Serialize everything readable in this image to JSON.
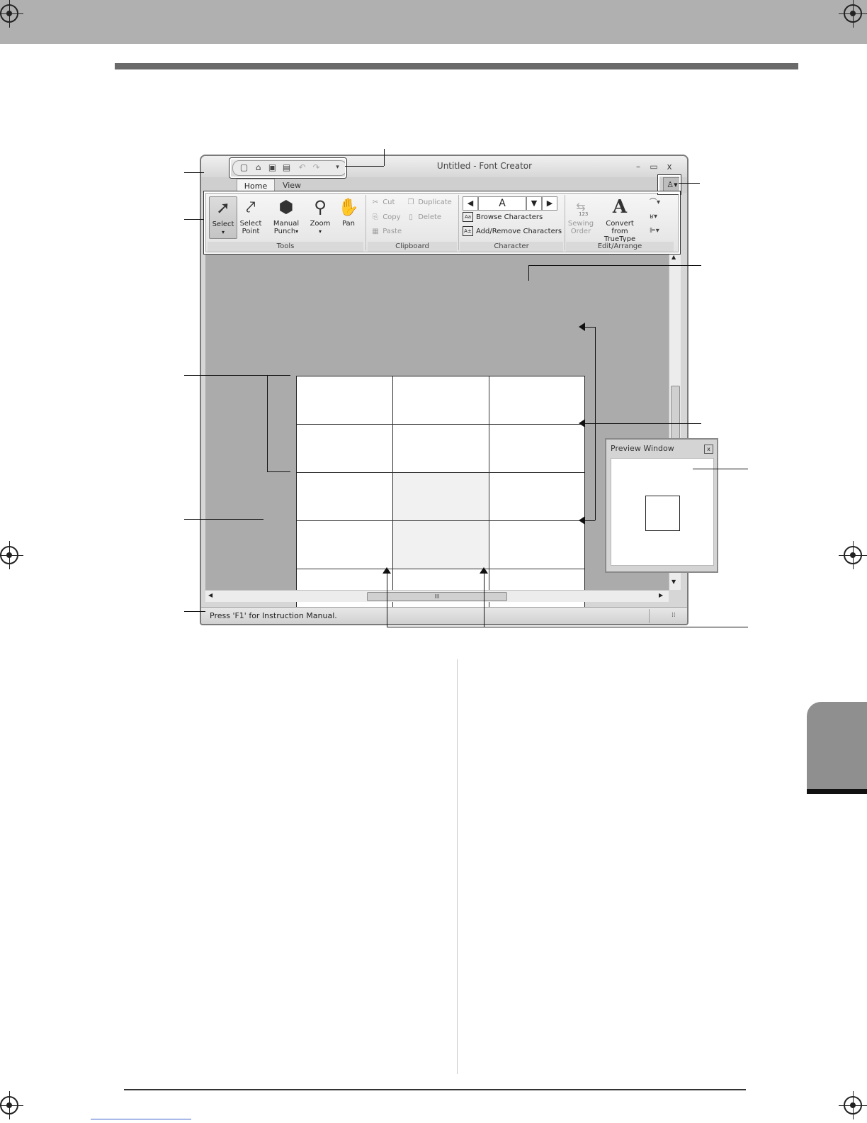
{
  "window": {
    "title": "Untitled - Font Creator",
    "app_button_glyph": "A",
    "controls": {
      "minimize": "–",
      "maximize": "▭",
      "close": "x"
    }
  },
  "quick_access": [
    "new-icon",
    "open-icon",
    "save-icon",
    "save-as-icon",
    "undo-icon",
    "redo-icon"
  ],
  "tabs": {
    "home": "Home",
    "view": "View"
  },
  "ribbon": {
    "tools": {
      "label": "Tools",
      "select": "Select",
      "select_point_1": "Select",
      "select_point_2": "Point",
      "manual_1": "Manual",
      "manual_2": "Punch",
      "zoom": "Zoom",
      "pan": "Pan"
    },
    "clipboard": {
      "label": "Clipboard",
      "cut": "Cut",
      "duplicate": "Duplicate",
      "copy": "Copy",
      "delete": "Delete",
      "paste": "Paste"
    },
    "character": {
      "label": "Character",
      "current": "A",
      "browse": "Browse Characters",
      "add_remove": "Add/Remove Characters"
    },
    "edit_arrange": {
      "label": "Edit/Arrange",
      "sewing_1": "Sewing",
      "sewing_2": "Order",
      "sewing_num": "123",
      "convert_1": "Convert from",
      "convert_2": "TrueType"
    }
  },
  "preview": {
    "title": "Preview Window",
    "close": "x"
  },
  "status": {
    "text": "Press 'F1' for Instruction Manual."
  },
  "scroll": {
    "hthumb_grip": "III"
  }
}
